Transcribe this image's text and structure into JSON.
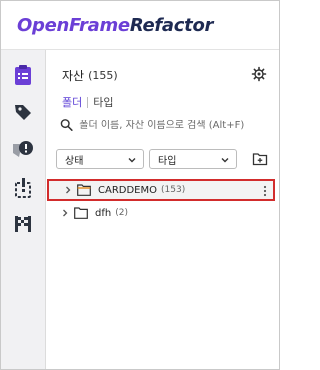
{
  "app": {
    "brand_part1": "OpenFrame",
    "brand_part2": "Refactor"
  },
  "rail": {
    "items": [
      "assets-icon",
      "tag-icon",
      "alert-icon",
      "issue-icon",
      "finish-flag-icon"
    ]
  },
  "panel": {
    "title": "자산",
    "count": "(155)",
    "tabs": [
      {
        "label": "폴더",
        "active": true
      },
      {
        "label": "타입",
        "active": false
      }
    ],
    "search_placeholder": "폴더 이름, 자산 이름으로 검색 (Alt+F)",
    "filters": {
      "status_label": "상태",
      "type_label": "타입"
    },
    "tree": [
      {
        "label": "CARDDEMO",
        "count": "(153)",
        "selected": true
      },
      {
        "label": "dfh",
        "count": "(2)",
        "selected": false
      }
    ]
  },
  "colors": {
    "accent": "#6b3fd6",
    "brand_dark": "#1e2a52",
    "selection_border": "#d22c2c"
  }
}
